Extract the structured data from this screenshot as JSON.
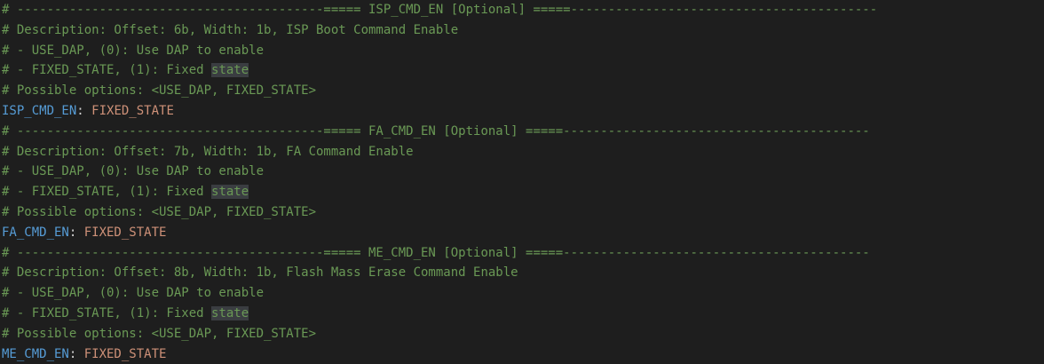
{
  "blocks": [
    {
      "header": "# -----------------------------------------===== ISP_CMD_EN [Optional] =====-----------------------------------------",
      "description": "# Description: Offset: 6b, Width: 1b, ISP Boot Command Enable",
      "opt1": "# - USE_DAP, (0): Use DAP to enable",
      "opt2_pre": "# - FIXED_STATE, (1): Fixed ",
      "opt2_hl": "state",
      "possible": "# Possible options: <USE_DAP, FIXED_STATE>",
      "key": "ISP_CMD_EN",
      "colon": ": ",
      "value": "FIXED_STATE"
    },
    {
      "header": "# -----------------------------------------===== FA_CMD_EN [Optional] =====-----------------------------------------",
      "description": "# Description: Offset: 7b, Width: 1b, FA Command Enable",
      "opt1": "# - USE_DAP, (0): Use DAP to enable",
      "opt2_pre": "# - FIXED_STATE, (1): Fixed ",
      "opt2_hl": "state",
      "possible": "# Possible options: <USE_DAP, FIXED_STATE>",
      "key": "FA_CMD_EN",
      "colon": ": ",
      "value": "FIXED_STATE"
    },
    {
      "header": "# -----------------------------------------===== ME_CMD_EN [Optional] =====-----------------------------------------",
      "description": "# Description: Offset: 8b, Width: 1b, Flash Mass Erase Command Enable",
      "opt1": "# - USE_DAP, (0): Use DAP to enable",
      "opt2_pre": "# - FIXED_STATE, (1): Fixed ",
      "opt2_hl": "state",
      "possible": "# Possible options: <USE_DAP, FIXED_STATE>",
      "key": "ME_CMD_EN",
      "colon": ": ",
      "value": "FIXED_STATE"
    }
  ],
  "colors": {
    "background": "#1e1e1e",
    "comment": "#6a9955",
    "key": "#569cd6",
    "value": "#ce9178",
    "highlight": "#3a3d41"
  }
}
